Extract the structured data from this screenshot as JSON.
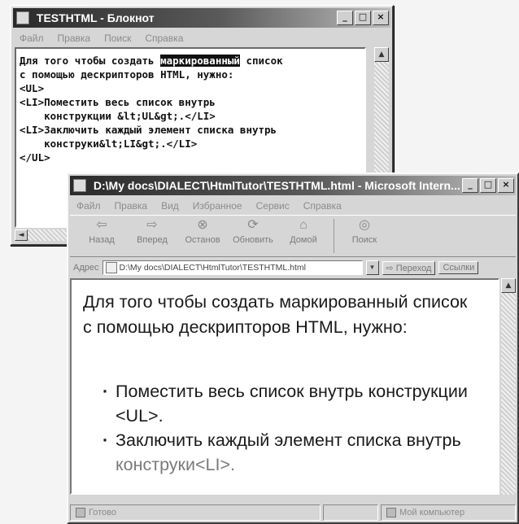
{
  "notepad": {
    "title": "TESTHTML - Блокнот",
    "menu": [
      "Файл",
      "Правка",
      "Поиск",
      "Справка"
    ],
    "lines": [
      {
        "pre": "Для того чтобы создать ",
        "sel": "маркированный",
        "post": " список"
      },
      {
        "pre": "с помощью дескрипторов HTML, нужно:",
        "sel": "",
        "post": ""
      },
      {
        "pre": "<UL>",
        "sel": "",
        "post": ""
      },
      {
        "pre": "<LI>Поместить весь список внутрь",
        "sel": "",
        "post": ""
      },
      {
        "pre": "    конструкции &lt;UL&gt;.</LI>",
        "sel": "",
        "post": ""
      },
      {
        "pre": "<LI>Заключить каждый элемент списка внутрь",
        "sel": "",
        "post": ""
      },
      {
        "pre": "    конструки&lt;LI&gt;.</LI>",
        "sel": "",
        "post": ""
      },
      {
        "pre": "</UL>",
        "sel": "",
        "post": ""
      }
    ]
  },
  "browser": {
    "title": "D:\\My docs\\DIALECT\\HtmlTutor\\TESTHTML.html - Microsoft Intern...",
    "menu": [
      "Файл",
      "Правка",
      "Вид",
      "Избранное",
      "Сервис",
      "Справка"
    ],
    "toolbar": {
      "back": "Назад",
      "forward": "Вперед",
      "stop": "Останов",
      "refresh": "Обновить",
      "home": "Домой",
      "search": "Поиск"
    },
    "address_label": "Адрес",
    "address_value": "D:\\My docs\\DIALECT\\HtmlTutor\\TESTHTML.html",
    "go_label": "Переход",
    "links_label": "Ссылки",
    "content": {
      "paragraph": "Для того чтобы создать маркированный список с помощью дескрипторов HTML, нужно:",
      "bullet1": "Поместить весь список внутрь конструкции <UL>.",
      "bullet2_text": "Заключить каждый элемент списка внутрь ",
      "bullet2_tail": "конструки<LI>."
    },
    "status_left": "Готово",
    "status_right": "Мой компьютер"
  }
}
